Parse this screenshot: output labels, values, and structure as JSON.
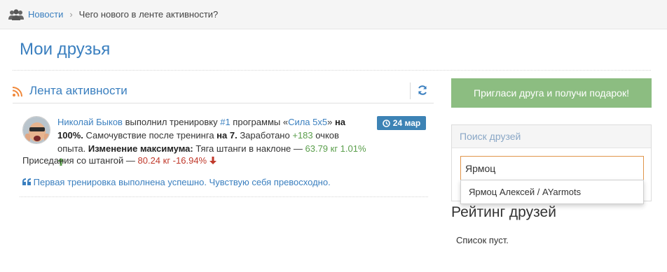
{
  "breadcrumb": {
    "home_label": "Новости",
    "current_label": "Чего нового в ленте активности?"
  },
  "page": {
    "title": "Мои друзья"
  },
  "feed": {
    "title": "Лента активности",
    "item": {
      "user_name": "Николай Быков",
      "text_did": " выполнил тренировку ",
      "workout_number": "#1",
      "text_program": " программы «",
      "program_name": "Сила 5x5",
      "text_program_end": "» ",
      "text_on": "на",
      "percent": "100%.",
      "text_feeling": " Самочувствие после тренинга ",
      "feeling_on": "на 7.",
      "text_earned": " Заработано ",
      "points": "+183",
      "text_points": " очков опыта. ",
      "max_change_label": "Изменение максимума:",
      "exercise1_name": " Тяга штанги в наклоне — ",
      "exercise1_value": "63.79 кг 1.01%",
      "exercise2_name": "Приседания со штангой — ",
      "exercise2_value": "80.24 кг -16.94%",
      "date": "24 мар",
      "comment": "Первая тренировка выполнена успешно. Чувствую себя превосходно."
    }
  },
  "sidebar": {
    "invite_button": "Пригласи друга и получи подарок!",
    "search_title": "Поиск друзей",
    "search_value": "Ярмоц",
    "suggestion": "Ярмоц Алексей / AYarmots",
    "rating_title": "Рейтинг друзей",
    "rating_empty": "Список пуст."
  },
  "colors": {
    "link": "#3a7fbf",
    "invite_bg": "#8cbd81",
    "badge_bg": "#3d83b5",
    "up_green": "#5a9e4b",
    "down_red": "#c0392b",
    "rss_orange": "#f0883a"
  },
  "icons": [
    "users-icon",
    "rss-icon",
    "refresh-icon",
    "clock-icon",
    "arrow-up-icon",
    "arrow-down-icon",
    "quote-icon",
    "chevron-right-icon"
  ]
}
